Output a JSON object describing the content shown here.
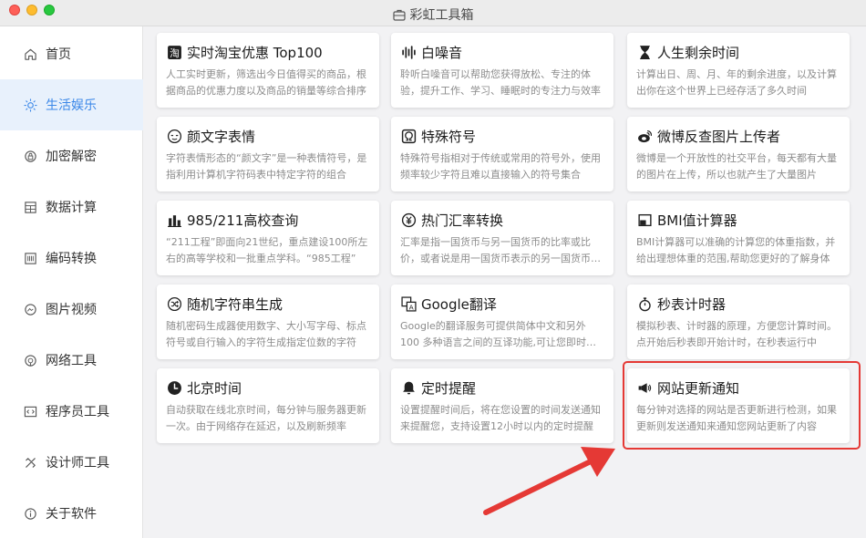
{
  "window": {
    "title": "彩虹工具箱"
  },
  "sidebar": {
    "items": [
      {
        "label": "首页",
        "icon": "home-icon",
        "active": false
      },
      {
        "label": "生活娱乐",
        "icon": "sun-icon",
        "active": true
      },
      {
        "label": "加密解密",
        "icon": "lock-icon",
        "active": false
      },
      {
        "label": "数据计算",
        "icon": "calculator-icon",
        "active": false
      },
      {
        "label": "编码转换",
        "icon": "barcode-icon",
        "active": false
      },
      {
        "label": "图片视频",
        "icon": "image-icon",
        "active": false
      },
      {
        "label": "网络工具",
        "icon": "network-icon",
        "active": false
      },
      {
        "label": "程序员工具",
        "icon": "code-icon",
        "active": false
      },
      {
        "label": "设计师工具",
        "icon": "design-icon",
        "active": false
      },
      {
        "label": "关于软件",
        "icon": "info-icon",
        "active": false
      }
    ]
  },
  "cards": [
    {
      "title": "实时淘宝优惠 Top100",
      "icon": "taobao-icon",
      "desc": "人工实时更新，筛选出今日值得买的商品，根据商品的优惠力度以及商品的销量等综合排序"
    },
    {
      "title": "白噪音",
      "icon": "sound-wave-icon",
      "desc": "聆听白噪音可以帮助您获得放松、专注的体验，提升工作、学习、睡眠时的专注力与效率"
    },
    {
      "title": "人生剩余时间",
      "icon": "hourglass-icon",
      "desc": "计算出日、周、月、年的剩余进度，以及计算出你在这个世界上已经存活了多久时间"
    },
    {
      "title": "颜文字表情",
      "icon": "emoticon-icon",
      "desc": "字符表情形态的“颜文字”是一种表情符号，是指利用计算机字符码表中特定字符的组合"
    },
    {
      "title": "特殊符号",
      "icon": "omega-icon",
      "desc": "特殊符号指相对于传统或常用的符号外，使用频率较少字符且难以直接输入的符号集合"
    },
    {
      "title": "微博反查图片上传者",
      "icon": "weibo-icon",
      "desc": "微博是一个开放性的社交平台，每天都有大量的图片在上传，所以也就产生了大量图片"
    },
    {
      "title": "985/211高校查询",
      "icon": "university-icon",
      "desc": "“211工程”即面向21世纪，重点建设100所左右的高等学校和一批重点学科。“985工程”"
    },
    {
      "title": "热门汇率转换",
      "icon": "currency-icon",
      "desc": "汇率是指一国货币与另一国货币的比率或比价，或者说是用一国货币表示的另一国货币价格"
    },
    {
      "title": "BMI值计算器",
      "icon": "bmi-icon",
      "desc": "BMI计算器可以准确的计算您的体重指数，并给出理想体重的范围,帮助您更好的了解身体"
    },
    {
      "title": "随机字符串生成",
      "icon": "shuffle-icon",
      "desc": "随机密码生成器使用数字、大小写字母、标点符号或自行输入的字符生成指定位数的字符"
    },
    {
      "title": "Google翻译",
      "icon": "translate-icon",
      "desc": "Google的翻译服务可提供简体中文和另外100 多种语言之间的互译功能,可让您即时翻译"
    },
    {
      "title": "秒表计时器",
      "icon": "stopwatch-icon",
      "desc": "模拟秒表、计时器的原理，方便您计算时间。点开始后秒表即开始计时，在秒表运行中"
    },
    {
      "title": "北京时间",
      "icon": "clock-icon",
      "desc": "自动获取在线北京时间，每分钟与服务器更新一次。由于网络存在延迟，以及刷新频率"
    },
    {
      "title": "定时提醒",
      "icon": "bell-icon",
      "desc": "设置提醒时间后，将在您设置的时间发送通知来提醒您，支持设置12小时以内的定时提醒"
    },
    {
      "title": "网站更新通知",
      "icon": "megaphone-icon",
      "desc": "每分钟对选择的网站是否更新进行检测，如果更新则发送通知来通知您网站更新了内容"
    }
  ],
  "colors": {
    "accent": "#3c88e8",
    "active_bg": "#e8f1fc",
    "highlight": "#e53935"
  }
}
